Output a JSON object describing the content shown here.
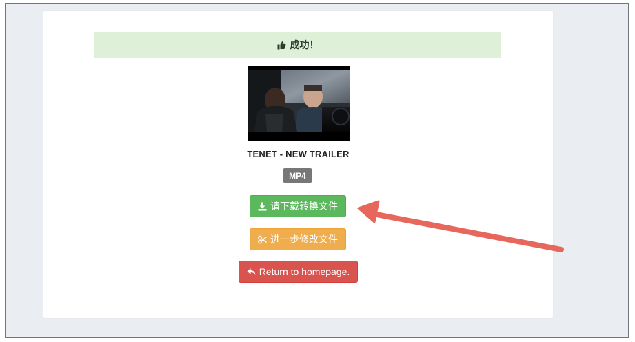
{
  "alert": {
    "icon": "thumbs-up-icon",
    "text": "成功！"
  },
  "video": {
    "title": "TENET - NEW TRAILER",
    "format": "MP4"
  },
  "buttons": {
    "download": {
      "icon": "download-icon",
      "label": "请下载转换文件"
    },
    "edit": {
      "icon": "scissors-icon",
      "label": "进一步修改文件"
    },
    "home": {
      "icon": "reply-icon",
      "label": "Return to homepage."
    }
  },
  "colors": {
    "alert_bg": "#dff0d8",
    "success": "#5cb85c",
    "warning": "#f0ad4e",
    "danger": "#d9534f",
    "badge": "#777777",
    "annotation_arrow": "#e8675c"
  }
}
